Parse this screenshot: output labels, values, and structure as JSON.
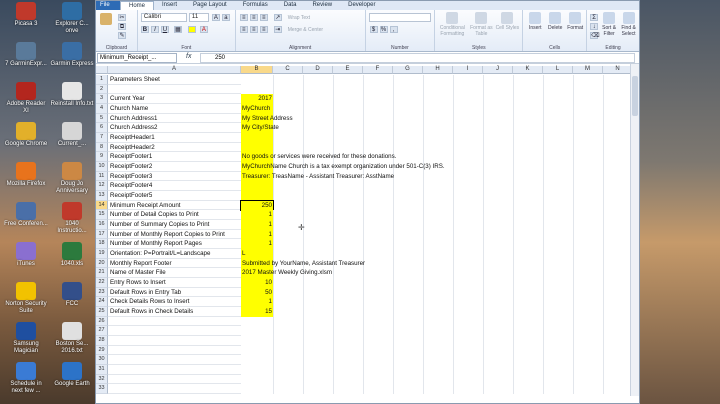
{
  "desktop": {
    "icons": [
      {
        "label": "Picasa 3",
        "color": "#c0392b"
      },
      {
        "label": "Explorer C...\nonve",
        "color": "#2e6da4"
      },
      {
        "label": "7 GarminExpr...",
        "color": "#5a7a9a"
      },
      {
        "label": "Garmin Express",
        "color": "#3a6ea5"
      },
      {
        "label": "Adobe Reader XI",
        "color": "#b3261e"
      },
      {
        "label": "Reinstall Info.txt",
        "color": "#e6e6e6"
      },
      {
        "label": "Google Chrome",
        "color": "#e2b02a"
      },
      {
        "label": "Current_...",
        "color": "#d6d6d6"
      },
      {
        "label": "Mozilla Firefox",
        "color": "#e8731c"
      },
      {
        "label": "Doug Jo Anniversary",
        "color": "#cc8844"
      },
      {
        "label": "Free Conferen...",
        "color": "#4a6fa8"
      },
      {
        "label": "1040 Instructio...",
        "color": "#c0392b"
      },
      {
        "label": "iTunes",
        "color": "#8a6fd0"
      },
      {
        "label": "1040.xls",
        "color": "#2c7a3d"
      },
      {
        "label": "Norton Security Suite",
        "color": "#f2c200"
      },
      {
        "label": "FCC",
        "color": "#334f8a"
      },
      {
        "label": "Samsung Magician",
        "color": "#1f4fa0"
      },
      {
        "label": "Boston Se... 2016.txt",
        "color": "#e0e0e0"
      },
      {
        "label": "Schedule in next few ...",
        "color": "#3a7bd5"
      },
      {
        "label": "Google Earth",
        "color": "#2c73c8"
      }
    ]
  },
  "excel": {
    "tabs": [
      "File",
      "Home",
      "Insert",
      "Page Layout",
      "Formulas",
      "Data",
      "Review",
      "Developer"
    ],
    "active_tab": "Home",
    "ribbon": {
      "font_name": "Calibri",
      "font_size": "11",
      "wrap_text": "Wrap Text",
      "merge_center": "Merge & Center",
      "groups": [
        "Clipboard",
        "Font",
        "Alignment",
        "Number",
        "Styles",
        "Cells",
        "Editing"
      ],
      "buttons": [
        "Conditional Formatting",
        "Format as Table",
        "Cell Styles",
        "Insert",
        "Delete",
        "Format",
        "Sort & Filter",
        "Find & Select"
      ]
    },
    "name_box": "Minimum_Receipt_...",
    "formula_value": "250",
    "columns": [
      "A",
      "B",
      "C",
      "D",
      "E",
      "F",
      "G",
      "H",
      "I",
      "J",
      "K",
      "L",
      "M",
      "N"
    ],
    "selected_column": "B",
    "selected_row": "14",
    "rows": [
      {
        "n": "1",
        "a": "Parameters Sheet",
        "b": ""
      },
      {
        "n": "2",
        "a": "",
        "b": ""
      },
      {
        "n": "3",
        "a": "Current Year",
        "b": "2017"
      },
      {
        "n": "4",
        "a": "Church Name",
        "b": "MyChurch"
      },
      {
        "n": "5",
        "a": "Church Address1",
        "b": "My Street Address"
      },
      {
        "n": "6",
        "a": "Church Address2",
        "b": "My City/State"
      },
      {
        "n": "7",
        "a": "ReceiptHeader1",
        "b": ""
      },
      {
        "n": "8",
        "a": "ReceiptHeader2",
        "b": ""
      },
      {
        "n": "9",
        "a": "ReceiptFooter1",
        "b": "No goods or services were received for these donations."
      },
      {
        "n": "10",
        "a": "ReceiptFooter2",
        "b": "MyChurchName Church is a tax exempt organization under 501-C(3) IRS."
      },
      {
        "n": "11",
        "a": "ReceiptFooter3",
        "b": "Treasurer: TreasName - Assistant Treasurer: AsstName"
      },
      {
        "n": "12",
        "a": "ReceiptFooter4",
        "b": ""
      },
      {
        "n": "13",
        "a": "ReceiptFooter5",
        "b": ""
      },
      {
        "n": "14",
        "a": "Minimum Receipt Amount",
        "b": "250"
      },
      {
        "n": "15",
        "a": "Number of Detail Copies to Print",
        "b": "1"
      },
      {
        "n": "16",
        "a": "Number of Summary Copies to Print",
        "b": "1"
      },
      {
        "n": "17",
        "a": "Number of Monthly Report Copies to Print",
        "b": "1"
      },
      {
        "n": "18",
        "a": "Number of Monthly Report Pages",
        "b": "1"
      },
      {
        "n": "19",
        "a": "Orientation: P=Portrait/L=Landscape",
        "b": "L"
      },
      {
        "n": "20",
        "a": "Monthly Report Footer",
        "b": "Submitted by YourName, Assistant Treasurer"
      },
      {
        "n": "21",
        "a": "Name of Master File",
        "b": "2017 Master Weekly Giving.xlsm"
      },
      {
        "n": "22",
        "a": "Entry Rows to Insert",
        "b": "10"
      },
      {
        "n": "23",
        "a": "Default Rows in Entry Tab",
        "b": "50"
      },
      {
        "n": "24",
        "a": "Check Details Rows to Insert",
        "b": "1"
      },
      {
        "n": "25",
        "a": "Default Rows in Check Details",
        "b": "15"
      },
      {
        "n": "26",
        "a": "",
        "b": ""
      },
      {
        "n": "27",
        "a": "",
        "b": ""
      },
      {
        "n": "28",
        "a": "",
        "b": ""
      },
      {
        "n": "29",
        "a": "",
        "b": ""
      },
      {
        "n": "30",
        "a": "",
        "b": ""
      },
      {
        "n": "31",
        "a": "",
        "b": ""
      },
      {
        "n": "32",
        "a": "",
        "b": ""
      },
      {
        "n": "33",
        "a": "",
        "b": ""
      }
    ]
  }
}
